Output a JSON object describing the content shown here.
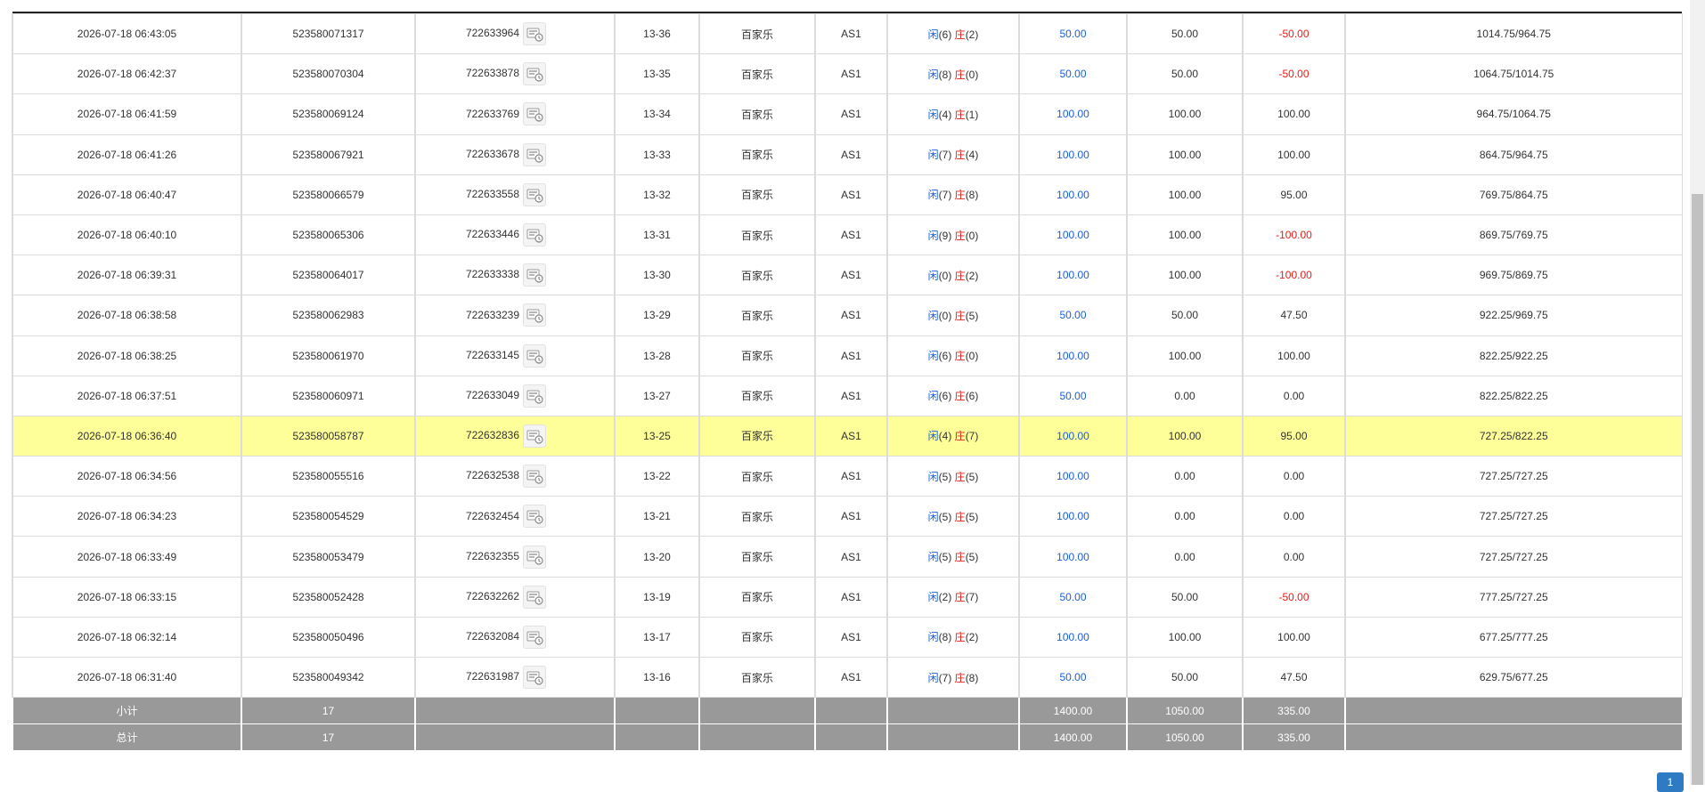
{
  "rows": [
    {
      "time": "2026-07-18 06:43:05",
      "order_no": "523580071317",
      "round_no": "722633964",
      "table": "13-36",
      "game": "百家乐",
      "room": "AS1",
      "xian": "闲",
      "xian_n": "(6)",
      "zhuang": "庄",
      "zhuang_n": "(2)",
      "bet": "50.00",
      "valid": "50.00",
      "payout": "-50.00",
      "payout_neg": true,
      "balance": "1014.75/964.75"
    },
    {
      "time": "2026-07-18 06:42:37",
      "order_no": "523580070304",
      "round_no": "722633878",
      "table": "13-35",
      "game": "百家乐",
      "room": "AS1",
      "xian": "闲",
      "xian_n": "(8)",
      "zhuang": "庄",
      "zhuang_n": "(0)",
      "bet": "50.00",
      "valid": "50.00",
      "payout": "-50.00",
      "payout_neg": true,
      "balance": "1064.75/1014.75"
    },
    {
      "time": "2026-07-18 06:41:59",
      "order_no": "523580069124",
      "round_no": "722633769",
      "table": "13-34",
      "game": "百家乐",
      "room": "AS1",
      "xian": "闲",
      "xian_n": "(4)",
      "zhuang": "庄",
      "zhuang_n": "(1)",
      "bet": "100.00",
      "valid": "100.00",
      "payout": "100.00",
      "payout_neg": false,
      "balance": "964.75/1064.75"
    },
    {
      "time": "2026-07-18 06:41:26",
      "order_no": "523580067921",
      "round_no": "722633678",
      "table": "13-33",
      "game": "百家乐",
      "room": "AS1",
      "xian": "闲",
      "xian_n": "(7)",
      "zhuang": "庄",
      "zhuang_n": "(4)",
      "bet": "100.00",
      "valid": "100.00",
      "payout": "100.00",
      "payout_neg": false,
      "balance": "864.75/964.75"
    },
    {
      "time": "2026-07-18 06:40:47",
      "order_no": "523580066579",
      "round_no": "722633558",
      "table": "13-32",
      "game": "百家乐",
      "room": "AS1",
      "xian": "闲",
      "xian_n": "(7)",
      "zhuang": "庄",
      "zhuang_n": "(8)",
      "bet": "100.00",
      "valid": "100.00",
      "payout": "95.00",
      "payout_neg": false,
      "balance": "769.75/864.75"
    },
    {
      "time": "2026-07-18 06:40:10",
      "order_no": "523580065306",
      "round_no": "722633446",
      "table": "13-31",
      "game": "百家乐",
      "room": "AS1",
      "xian": "闲",
      "xian_n": "(9)",
      "zhuang": "庄",
      "zhuang_n": "(0)",
      "bet": "100.00",
      "valid": "100.00",
      "payout": "-100.00",
      "payout_neg": true,
      "balance": "869.75/769.75"
    },
    {
      "time": "2026-07-18 06:39:31",
      "order_no": "523580064017",
      "round_no": "722633338",
      "table": "13-30",
      "game": "百家乐",
      "room": "AS1",
      "xian": "闲",
      "xian_n": "(0)",
      "zhuang": "庄",
      "zhuang_n": "(2)",
      "bet": "100.00",
      "valid": "100.00",
      "payout": "-100.00",
      "payout_neg": true,
      "balance": "969.75/869.75"
    },
    {
      "time": "2026-07-18 06:38:58",
      "order_no": "523580062983",
      "round_no": "722633239",
      "table": "13-29",
      "game": "百家乐",
      "room": "AS1",
      "xian": "闲",
      "xian_n": "(0)",
      "zhuang": "庄",
      "zhuang_n": "(5)",
      "bet": "50.00",
      "valid": "50.00",
      "payout": "47.50",
      "payout_neg": false,
      "balance": "922.25/969.75"
    },
    {
      "time": "2026-07-18 06:38:25",
      "order_no": "523580061970",
      "round_no": "722633145",
      "table": "13-28",
      "game": "百家乐",
      "room": "AS1",
      "xian": "闲",
      "xian_n": "(6)",
      "zhuang": "庄",
      "zhuang_n": "(0)",
      "bet": "100.00",
      "valid": "100.00",
      "payout": "100.00",
      "payout_neg": false,
      "balance": "822.25/922.25"
    },
    {
      "time": "2026-07-18 06:37:51",
      "order_no": "523580060971",
      "round_no": "722633049",
      "table": "13-27",
      "game": "百家乐",
      "room": "AS1",
      "xian": "闲",
      "xian_n": "(6)",
      "zhuang": "庄",
      "zhuang_n": "(6)",
      "bet": "50.00",
      "valid": "0.00",
      "payout": "0.00",
      "payout_neg": false,
      "balance": "822.25/822.25"
    },
    {
      "time": "2026-07-18 06:36:40",
      "order_no": "523580058787",
      "round_no": "722632836",
      "table": "13-25",
      "game": "百家乐",
      "room": "AS1",
      "xian": "闲",
      "xian_n": "(4)",
      "zhuang": "庄",
      "zhuang_n": "(7)",
      "bet": "100.00",
      "valid": "100.00",
      "payout": "95.00",
      "payout_neg": false,
      "balance": "727.25/822.25",
      "highlight": true
    },
    {
      "time": "2026-07-18 06:34:56",
      "order_no": "523580055516",
      "round_no": "722632538",
      "table": "13-22",
      "game": "百家乐",
      "room": "AS1",
      "xian": "闲",
      "xian_n": "(5)",
      "zhuang": "庄",
      "zhuang_n": "(5)",
      "bet": "100.00",
      "valid": "0.00",
      "payout": "0.00",
      "payout_neg": false,
      "balance": "727.25/727.25"
    },
    {
      "time": "2026-07-18 06:34:23",
      "order_no": "523580054529",
      "round_no": "722632454",
      "table": "13-21",
      "game": "百家乐",
      "room": "AS1",
      "xian": "闲",
      "xian_n": "(5)",
      "zhuang": "庄",
      "zhuang_n": "(5)",
      "bet": "100.00",
      "valid": "0.00",
      "payout": "0.00",
      "payout_neg": false,
      "balance": "727.25/727.25"
    },
    {
      "time": "2026-07-18 06:33:49",
      "order_no": "523580053479",
      "round_no": "722632355",
      "table": "13-20",
      "game": "百家乐",
      "room": "AS1",
      "xian": "闲",
      "xian_n": "(5)",
      "zhuang": "庄",
      "zhuang_n": "(5)",
      "bet": "100.00",
      "valid": "0.00",
      "payout": "0.00",
      "payout_neg": false,
      "balance": "727.25/727.25"
    },
    {
      "time": "2026-07-18 06:33:15",
      "order_no": "523580052428",
      "round_no": "722632262",
      "table": "13-19",
      "game": "百家乐",
      "room": "AS1",
      "xian": "闲",
      "xian_n": "(2)",
      "zhuang": "庄",
      "zhuang_n": "(7)",
      "bet": "50.00",
      "valid": "50.00",
      "payout": "-50.00",
      "payout_neg": true,
      "balance": "777.25/727.25"
    },
    {
      "time": "2026-07-18 06:32:14",
      "order_no": "523580050496",
      "round_no": "722632084",
      "table": "13-17",
      "game": "百家乐",
      "room": "AS1",
      "xian": "闲",
      "xian_n": "(8)",
      "zhuang": "庄",
      "zhuang_n": "(2)",
      "bet": "100.00",
      "valid": "100.00",
      "payout": "100.00",
      "payout_neg": false,
      "balance": "677.25/777.25"
    },
    {
      "time": "2026-07-18 06:31:40",
      "order_no": "523580049342",
      "round_no": "722631987",
      "table": "13-16",
      "game": "百家乐",
      "room": "AS1",
      "xian": "闲",
      "xian_n": "(7)",
      "zhuang": "庄",
      "zhuang_n": "(8)",
      "bet": "50.00",
      "valid": "50.00",
      "payout": "47.50",
      "payout_neg": false,
      "balance": "629.75/677.25"
    }
  ],
  "subtotal": {
    "label": "小计",
    "count": "17",
    "bet": "1400.00",
    "valid": "1050.00",
    "payout": "335.00"
  },
  "total": {
    "label": "总计",
    "count": "17",
    "bet": "1400.00",
    "valid": "1050.00",
    "payout": "335.00"
  },
  "pagination": {
    "current": "1"
  },
  "colors": {
    "blue": "#1a5fd8",
    "red": "#e0201a",
    "highlight": "#ffff99",
    "summary_bg": "#999999",
    "page_button": "#2e7bc4"
  },
  "icons": {
    "round_detail": "game-detail-icon"
  }
}
